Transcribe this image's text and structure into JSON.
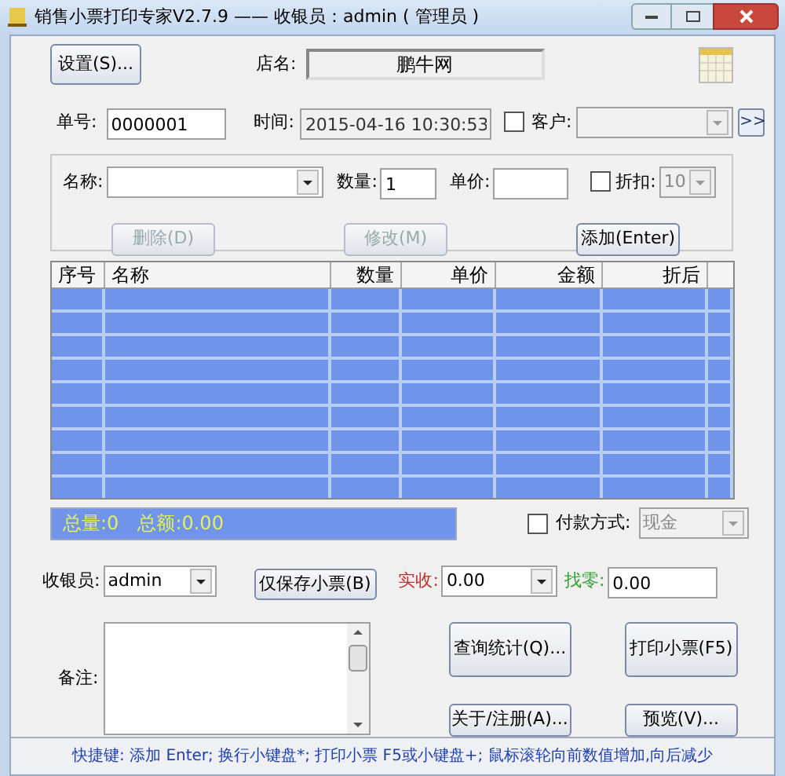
{
  "window": {
    "title": "销售小票打印专家V2.7.9 —— 收银员：admin ( 管理员 )"
  },
  "header": {
    "settings_button": "设置(S)...",
    "shop_label": "店名:",
    "shop_name": "鹏牛网"
  },
  "order": {
    "number_label": "单号:",
    "number": "0000001",
    "time_label": "时间:",
    "time": "2015-04-16 10:30:53",
    "customer_label": "客户:",
    "customer_checked": false,
    "more_button": ">>"
  },
  "item_entry": {
    "name_label": "名称:",
    "quantity_label": "数量:",
    "quantity": "1",
    "price_label": "单价:",
    "discount_label": "折扣:",
    "discount_checked": false,
    "discount": "10",
    "buttons": [
      {
        "label": "删除(D)",
        "disabled": true
      },
      {
        "label": "修改(M)",
        "disabled": true
      },
      {
        "label": "添加(Enter)",
        "disabled": false
      }
    ]
  },
  "table": {
    "columns": [
      "序号",
      "名称",
      "数量",
      "单价",
      "金额",
      "折后"
    ]
  },
  "summary": {
    "total_quantity": "总量:0",
    "total_amount": "总额:0.00"
  },
  "payment": {
    "label": "付款方式:",
    "checked": false,
    "method": "现金"
  },
  "cashier": {
    "label": "收银员:",
    "value": "admin",
    "save_button": "仅保存小票(B)",
    "received_label": "实收:",
    "received": "0.00",
    "change_label": "找零:",
    "change": "0.00"
  },
  "notes": {
    "label": "备注:"
  },
  "actions": [
    {
      "label": "查询统计(Q)..."
    },
    {
      "label": "打印小票(F5)"
    },
    {
      "label": "关于/注册(A)..."
    },
    {
      "label": "预览(V)..."
    }
  ],
  "status_bar": "快捷键: 添加 Enter; 换行小键盘*; 打印小票 F5或小键盘+; 鼠标滚轮向前数值增加,向后减少"
}
